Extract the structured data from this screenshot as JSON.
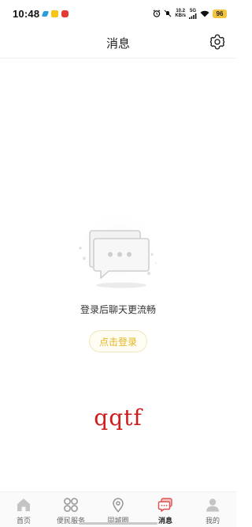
{
  "status_bar": {
    "time": "10:48",
    "net_speed_top": "10.2",
    "net_speed_bottom": "KB/s",
    "network_type": "5G",
    "battery": "96"
  },
  "header": {
    "title": "消息"
  },
  "empty_state": {
    "message": "登录后聊天更流畅",
    "login_button": "点击登录"
  },
  "watermark": "qqtf",
  "tabs": [
    {
      "label": "首页",
      "icon": "home-icon"
    },
    {
      "label": "便民服务",
      "icon": "grid-icon"
    },
    {
      "label": "同城圈",
      "icon": "location-icon"
    },
    {
      "label": "消息",
      "icon": "chat-icon",
      "active": true
    },
    {
      "label": "我的",
      "icon": "user-icon"
    }
  ],
  "colors": {
    "active_tab": "#e05050",
    "inactive_tab": "#bfbfbf",
    "accent_yellow": "#e3b51f",
    "watermark_red": "#d11a1a"
  }
}
